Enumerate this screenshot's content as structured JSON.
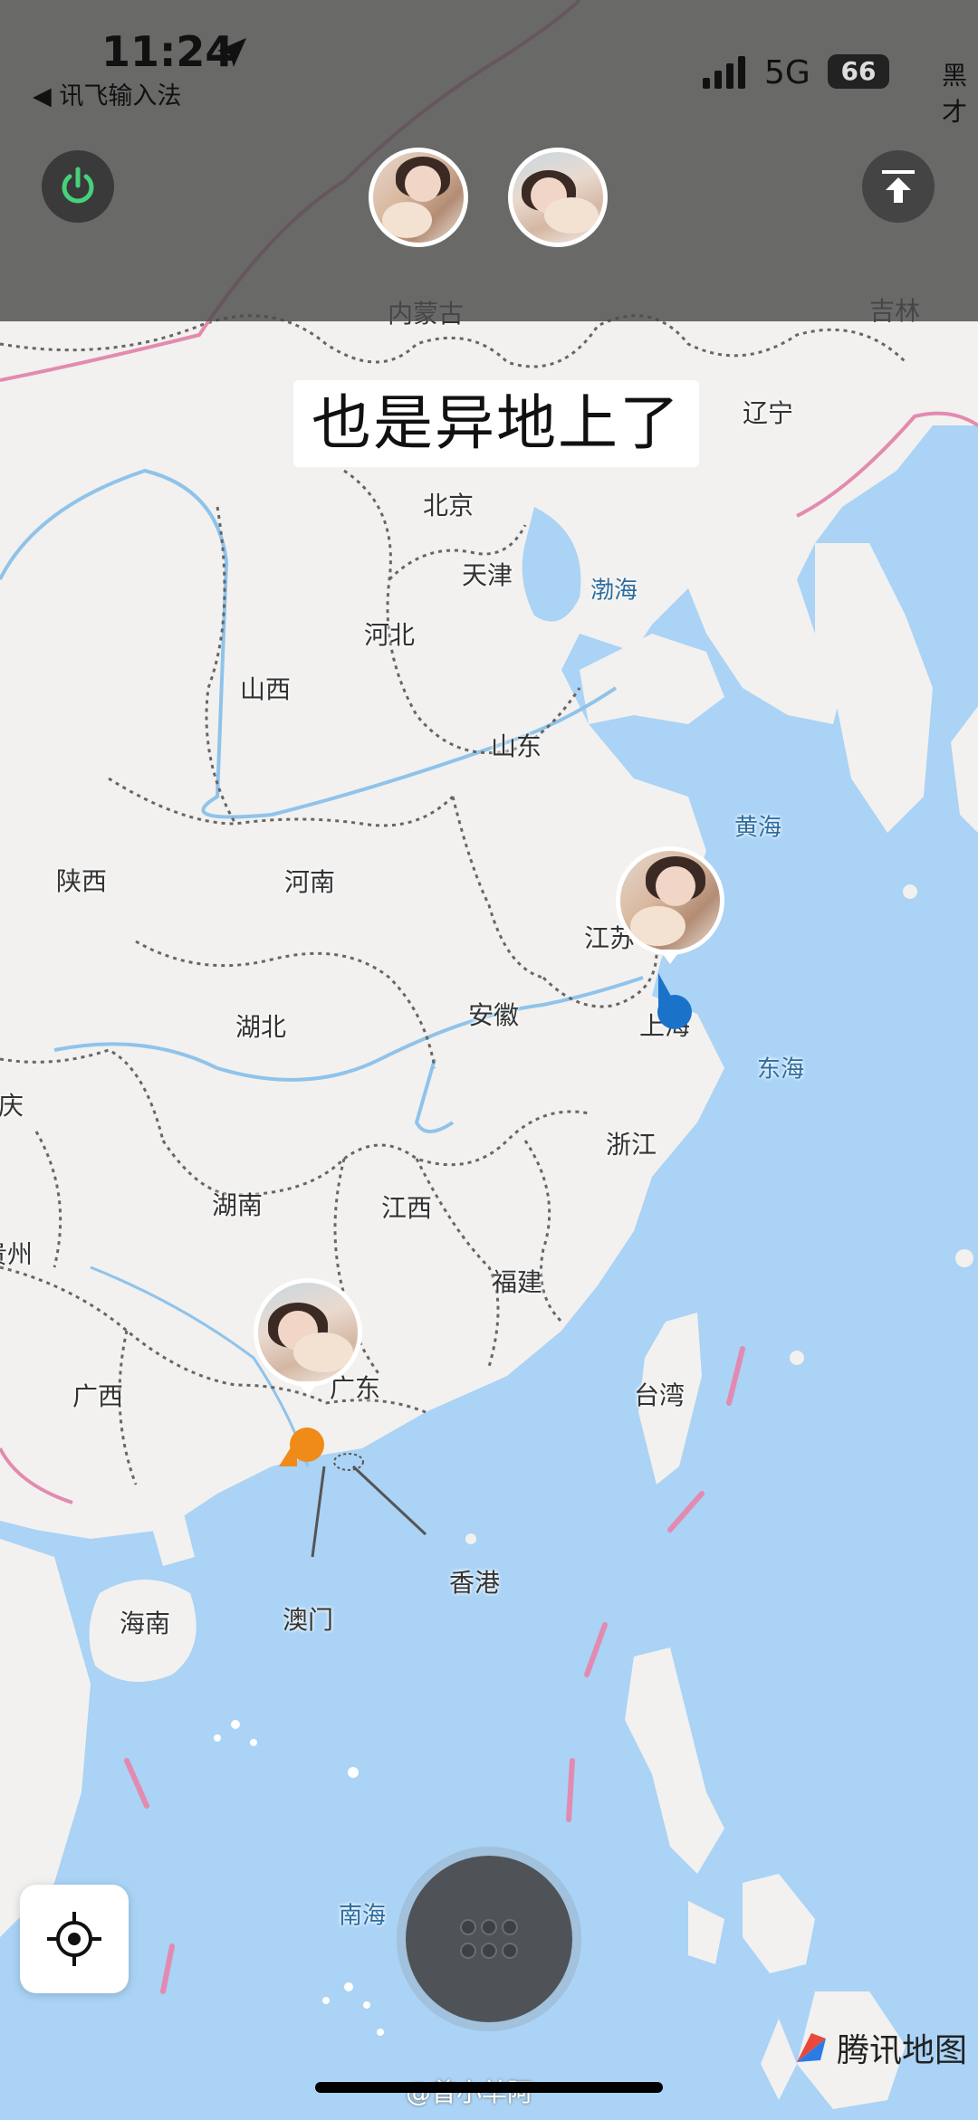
{
  "status_bar": {
    "time": "11:24",
    "back_app": "◀ 讯飞输入法",
    "network": "5G",
    "battery": "66",
    "right_text": "黑才"
  },
  "banner_text": "也是异地上了",
  "map": {
    "provinces": {
      "nei_menggu": "内蒙古",
      "jilin": "吉林",
      "liaoning": "辽宁",
      "beijing": "北京",
      "tianjin": "天津",
      "hebei": "河北",
      "shanxi": "山西",
      "shandong": "山东",
      "shaanxi": "陕西",
      "henan": "河南",
      "jiangsu": "江苏",
      "shanghai": "上海",
      "anhui": "安徽",
      "hubei": "湖北",
      "chongqing": "庆",
      "zhejiang": "浙江",
      "hunan": "湖南",
      "jiangxi": "江西",
      "guizhou": "贵州",
      "fujian": "福建",
      "guangxi": "广西",
      "guangdong": "广东",
      "taiwan": "台湾",
      "hainan": "海南",
      "macau": "澳门",
      "hongkong": "香港"
    },
    "seas": {
      "bohai": "渤海",
      "huanghai": "黄海",
      "donghai": "东海",
      "nanhai": "南海"
    }
  },
  "watermark": {
    "tencent_map": "腾讯地图",
    "weibo": "@曾小羊阿"
  },
  "colors": {
    "sea": "#aad3f5",
    "land": "#f2f1ef",
    "user_blue": "#1a72c9",
    "user_orange": "#f08a18",
    "power_icon": "#46d17a"
  },
  "icons": {
    "power": "power-icon",
    "collapse": "arrow-to-top-icon",
    "locate": "crosshair-icon",
    "menu": "grid-dots-icon",
    "location_arrow": "location-arrow-icon"
  }
}
